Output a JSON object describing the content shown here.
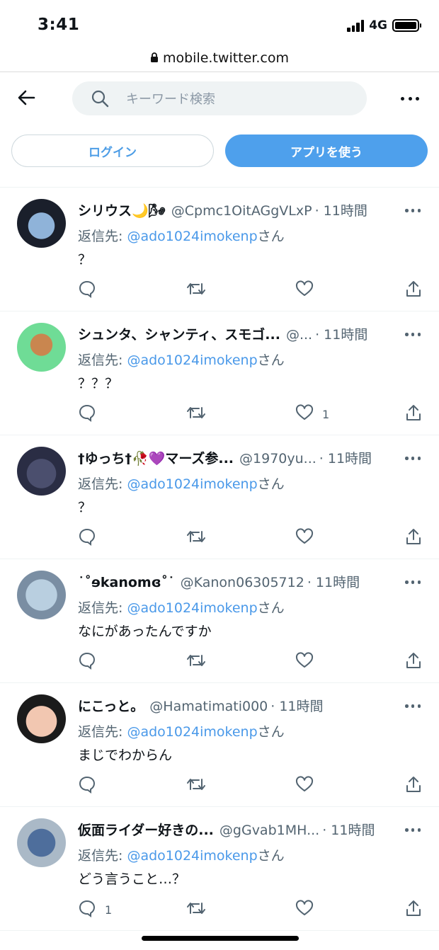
{
  "status_bar": {
    "time": "3:41",
    "network": "4G",
    "battery_level": 1.0
  },
  "browser": {
    "url": "mobile.twitter.com"
  },
  "header": {
    "search_placeholder": "キーワード検索"
  },
  "auth": {
    "login_label": "ログイン",
    "app_label": "アプリを使う"
  },
  "colors": {
    "accent": "#4ea0ec",
    "link": "#4a99e9",
    "secondary_text": "#536471"
  },
  "tweets": [
    {
      "name": "シリウス🌙🌬",
      "handle": "@Cpmc1OitAGgVLxP",
      "time": "· 11時間",
      "reply_prefix": "返信先: ",
      "reply_handle": "@ado1024imokenp",
      "reply_suffix": "さん",
      "text": "？",
      "reply_count": "",
      "like_count": ""
    },
    {
      "name": "シュンタ、シャンティ、スモゴ...",
      "handle": "@...",
      "time": "· 11時間",
      "reply_prefix": "返信先: ",
      "reply_handle": "@ado1024imokenp",
      "reply_suffix": "さん",
      "text": "？？？",
      "reply_count": "",
      "like_count": "1"
    },
    {
      "name": "†ゆっち†🥀💜マーズ参...",
      "handle": "@1970yu...",
      "time": "· 11時間",
      "reply_prefix": "返信先: ",
      "reply_handle": "@ado1024imokenp",
      "reply_suffix": "さん",
      "text": "？",
      "reply_count": "",
      "like_count": ""
    },
    {
      "name": "˙˚ɘkanomɞ˚˙",
      "handle": "@Kanon06305712",
      "time": "· 11時間",
      "reply_prefix": "返信先: ",
      "reply_handle": "@ado1024imokenp",
      "reply_suffix": "さん",
      "text": "なにがあったんですか",
      "reply_count": "",
      "like_count": ""
    },
    {
      "name": "にこっと。",
      "handle": "@Hamatimati000",
      "time": "· 11時間",
      "reply_prefix": "返信先: ",
      "reply_handle": "@ado1024imokenp",
      "reply_suffix": "さん",
      "text": "まじでわからん",
      "reply_count": "",
      "like_count": ""
    },
    {
      "name": "仮面ライダー好きの...",
      "handle": "@gGvab1MH...",
      "time": "· 11時間",
      "reply_prefix": "返信先: ",
      "reply_handle": "@ado1024imokenp",
      "reply_suffix": "さん",
      "text": "どう言うこと…？",
      "reply_count": "1",
      "like_count": ""
    }
  ]
}
